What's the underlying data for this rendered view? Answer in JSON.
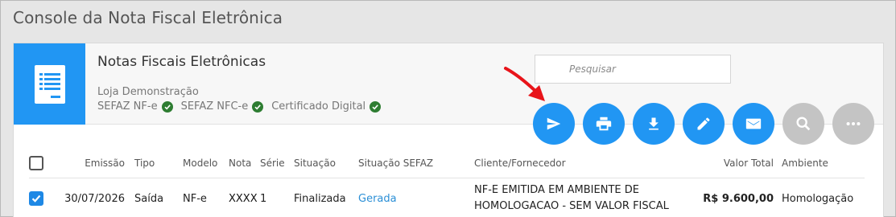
{
  "window": {
    "title": "Console da Nota Fiscal Eletrônica"
  },
  "card": {
    "title": "Notas Fiscais Eletrônicas",
    "store": "Loja Demonstração",
    "status": [
      {
        "label": "SEFAZ NF-e",
        "ok": true
      },
      {
        "label": "SEFAZ NFC-e",
        "ok": true
      },
      {
        "label": "Certificado Digital",
        "ok": true
      }
    ],
    "logo_icon": "document-list-icon",
    "accent_color": "#2196f3"
  },
  "search": {
    "placeholder": "Pesquisar",
    "value": ""
  },
  "actions": [
    {
      "name": "send",
      "icon": "send-icon",
      "color": "#2196f3"
    },
    {
      "name": "print",
      "icon": "print-icon",
      "color": "#2196f3"
    },
    {
      "name": "download",
      "icon": "download-icon",
      "color": "#2196f3"
    },
    {
      "name": "edit",
      "icon": "edit-icon",
      "color": "#2196f3"
    },
    {
      "name": "email",
      "icon": "email-icon",
      "color": "#2196f3"
    },
    {
      "name": "search",
      "icon": "search-icon",
      "color": "#c4c4c4"
    },
    {
      "name": "more",
      "icon": "more-icon",
      "color": "#c4c4c4"
    }
  ],
  "table": {
    "headers": {
      "emissao": "Emissão",
      "tipo": "Tipo",
      "modelo": "Modelo",
      "nota": "Nota",
      "serie": "Série",
      "situacao": "Situação",
      "situacao_sefaz": "Situação SEFAZ",
      "cliente": "Cliente/Fornecedor",
      "valor_total": "Valor Total",
      "ambiente": "Ambiente"
    },
    "rows": [
      {
        "selected": true,
        "emissao": "30/07/2026",
        "tipo": "Saída",
        "modelo": "NF-e",
        "nota": "XXXX",
        "serie": "1",
        "situacao": "Finalizada",
        "situacao_sefaz": "Gerada",
        "cliente_line1": "NF-E EMITIDA EM AMBIENTE DE",
        "cliente_line2": "HOMOLOGACAO - SEM VALOR FISCAL",
        "valor_total": "R$ 9.600,00",
        "ambiente": "Homologação"
      }
    ]
  },
  "annotation": {
    "type": "red-arrow",
    "points_to": "send",
    "color": "#e8141a"
  }
}
